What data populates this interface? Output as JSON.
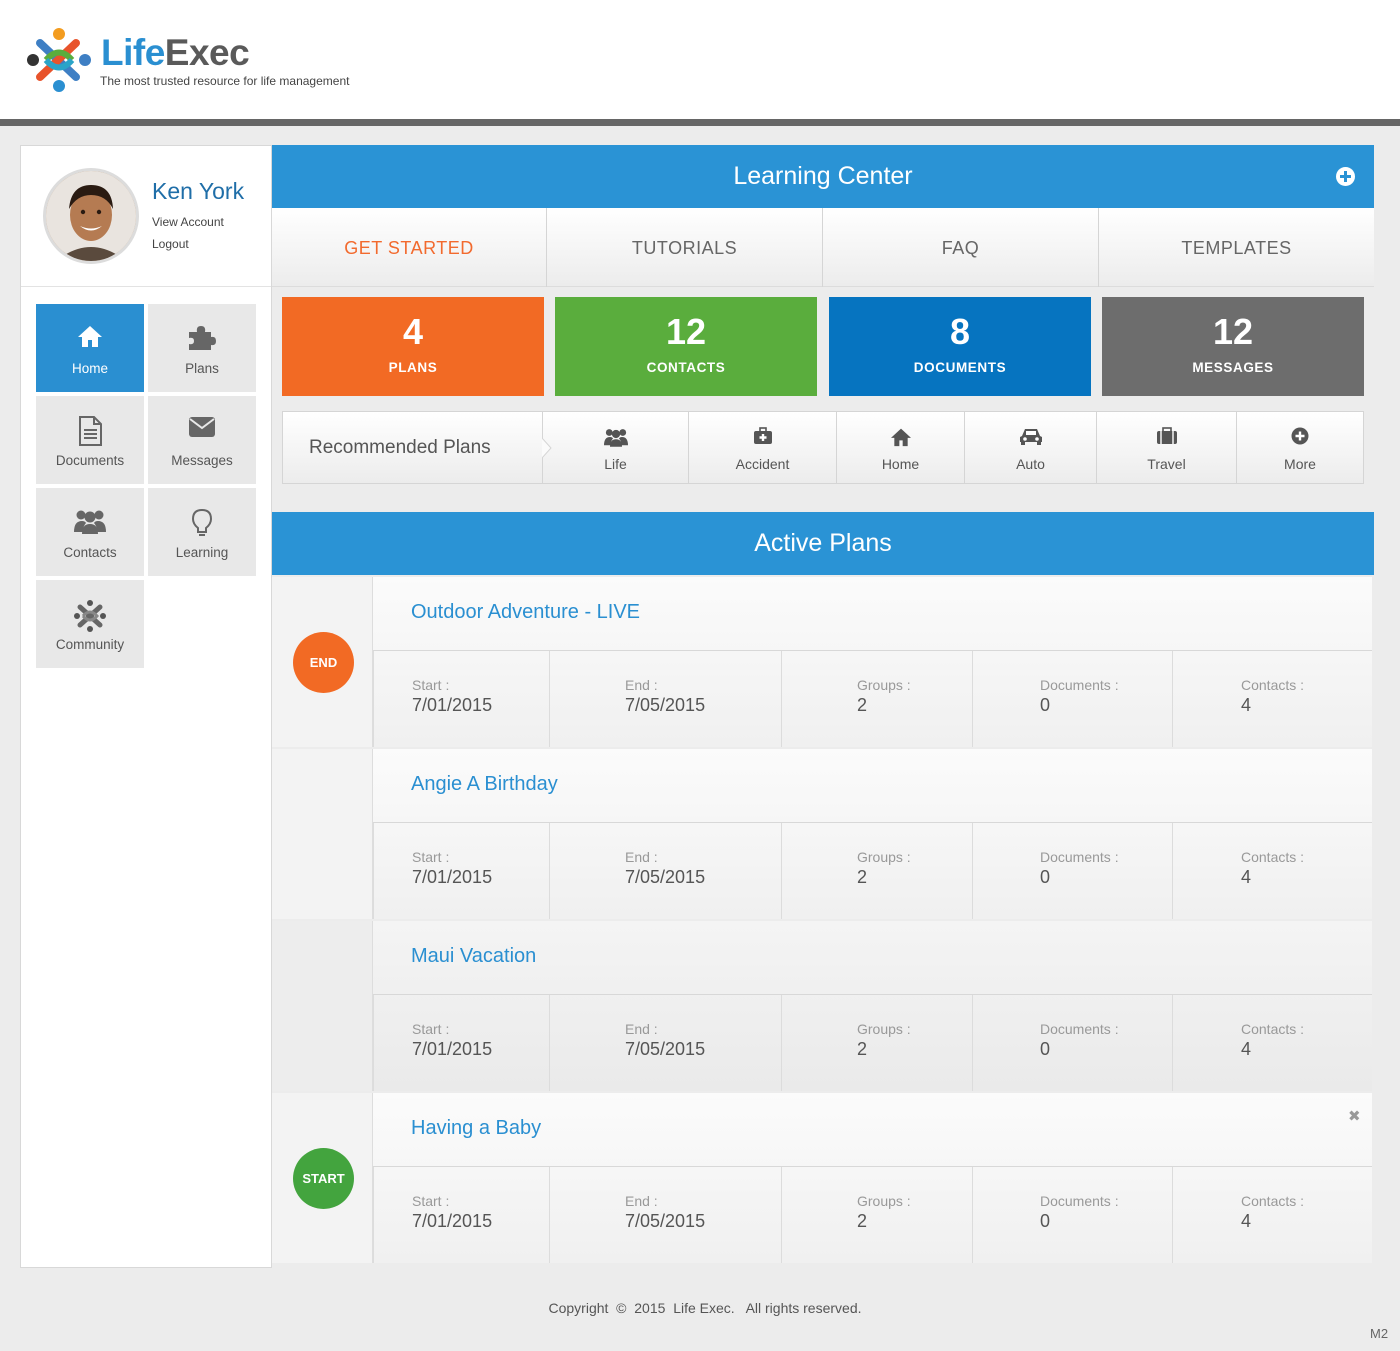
{
  "brand": {
    "name_part1": "Life",
    "name_part2": "Exec",
    "tagline": "The most trusted resource for life management"
  },
  "user": {
    "name": "Ken York",
    "view_account": "View Account",
    "logout": "Logout"
  },
  "sidebar": {
    "items": [
      {
        "label": "Home",
        "icon": "home-icon",
        "active": true
      },
      {
        "label": "Plans",
        "icon": "puzzle-icon"
      },
      {
        "label": "Documents",
        "icon": "document-icon"
      },
      {
        "label": "Messages",
        "icon": "envelope-icon"
      },
      {
        "label": "Contacts",
        "icon": "users-icon"
      },
      {
        "label": "Learning",
        "icon": "lightbulb-icon"
      },
      {
        "label": "Community",
        "icon": "community-icon"
      }
    ]
  },
  "learning_center": {
    "title": "Learning Center",
    "tabs": [
      {
        "label": "GET STARTED",
        "active": true
      },
      {
        "label": "TUTORIALS"
      },
      {
        "label": "FAQ"
      },
      {
        "label": "TEMPLATES"
      }
    ]
  },
  "stats": [
    {
      "value": "4",
      "label": "PLANS",
      "color": "#f26a24"
    },
    {
      "value": "12",
      "label": "CONTACTS",
      "color": "#5aad3d"
    },
    {
      "value": "8",
      "label": "DOCUMENTS",
      "color": "#0674c0"
    },
    {
      "value": "12",
      "label": "MESSAGES",
      "color": "#6d6d6d"
    }
  ],
  "recommended": {
    "title": "Recommended Plans",
    "items": [
      {
        "label": "Life",
        "icon": "users-icon"
      },
      {
        "label": "Accident",
        "icon": "medkit-icon"
      },
      {
        "label": "Home",
        "icon": "home-icon"
      },
      {
        "label": "Auto",
        "icon": "car-icon"
      },
      {
        "label": "Travel",
        "icon": "suitcase-icon"
      },
      {
        "label": "More",
        "icon": "plus-circle-icon"
      }
    ]
  },
  "active_plans": {
    "title": "Active Plans",
    "plans": [
      {
        "name": "Outdoor Adventure - LIVE",
        "badge": "END",
        "start_label": "Start :",
        "start": "7/01/2015",
        "end_label": "End :",
        "end": "7/05/2015",
        "groups_label": "Groups :",
        "groups": "2",
        "documents_label": "Documents :",
        "documents": "0",
        "contacts_label": "Contacts :",
        "contacts": "4"
      },
      {
        "name": "Angie A Birthday",
        "badge": "",
        "start_label": "Start :",
        "start": "7/01/2015",
        "end_label": "End :",
        "end": "7/05/2015",
        "groups_label": "Groups :",
        "groups": "2",
        "documents_label": "Documents :",
        "documents": "0",
        "contacts_label": "Contacts :",
        "contacts": "4"
      },
      {
        "name": "Maui Vacation",
        "badge": "",
        "start_label": "Start :",
        "start": "7/01/2015",
        "end_label": "End :",
        "end": "7/05/2015",
        "groups_label": "Groups :",
        "groups": "2",
        "documents_label": "Documents :",
        "documents": "0",
        "contacts_label": "Contacts :",
        "contacts": "4"
      },
      {
        "name": "Having a Baby",
        "badge": "START",
        "close": "✖",
        "start_label": "Start :",
        "start": "7/01/2015",
        "end_label": "End :",
        "end": "7/05/2015",
        "groups_label": "Groups :",
        "groups": "2",
        "documents_label": "Documents :",
        "documents": "0",
        "contacts_label": "Contacts :",
        "contacts": "4"
      }
    ]
  },
  "footer": {
    "copyright": "Copyright  ©  2015  Life Exec.   All rights reserved.",
    "corner": "M2"
  },
  "colors": {
    "accent": "#2a93d5",
    "end_badge": "#f26a24",
    "start_badge": "#43a43e",
    "link": "#2a8fd1"
  }
}
